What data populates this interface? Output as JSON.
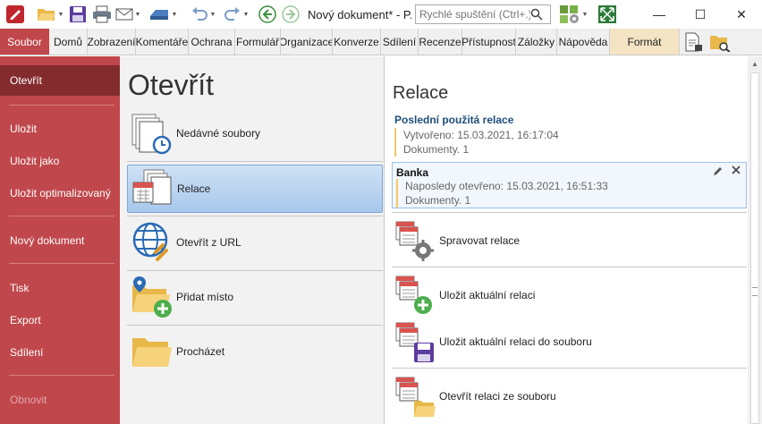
{
  "window": {
    "title": "Nový dokument* - P...",
    "quick_launch_placeholder": "Rychlé spuštění (Ctrl+.)",
    "minimize_label": "—",
    "maximize_label": "☐",
    "close_label": "✕"
  },
  "ribbon": {
    "tabs": [
      "Soubor",
      "Domů",
      "Zobrazení",
      "Komentáře",
      "Ochrana",
      "Formulář",
      "Organizace",
      "Konverze",
      "Sdílení",
      "Recenze",
      "Přístupnost",
      "Záložky",
      "Nápověda",
      "Formát"
    ]
  },
  "left_menu": {
    "items": [
      {
        "label": "Otevřít",
        "state": "active"
      },
      {
        "label": "Uložit",
        "state": "normal"
      },
      {
        "label": "Uložit jako",
        "state": "normal"
      },
      {
        "label": "Uložit optimalizovaný",
        "state": "normal"
      },
      {
        "label": "Nový dokument",
        "state": "normal"
      },
      {
        "label": "Tisk",
        "state": "normal"
      },
      {
        "label": "Export",
        "state": "normal"
      },
      {
        "label": "Sdílení",
        "state": "normal"
      },
      {
        "label": "Obnovit",
        "state": "disabled"
      }
    ]
  },
  "open_pane": {
    "title": "Otevřít",
    "items": [
      {
        "label": "Nedávné soubory",
        "icon": "recent-files-icon"
      },
      {
        "label": "Relace",
        "icon": "sessions-icon",
        "selected": true
      },
      {
        "label": "Otevřít z URL",
        "icon": "open-url-icon"
      },
      {
        "label": "Přidat místo",
        "icon": "add-place-icon"
      },
      {
        "label": "Procházet",
        "icon": "browse-folder-icon"
      }
    ]
  },
  "sessions_pane": {
    "title": "Relace",
    "recent_heading": "Poslední použitá relace",
    "recent_created": "Vytvořeno: 15.03.2021, 16:17:04",
    "recent_documents": "Dokumenty. 1",
    "session": {
      "name": "Banka",
      "last_opened": "Naposledy otevřeno: 15.03.2021, 16:51:33",
      "documents": "Dokumenty. 1"
    },
    "actions": [
      {
        "label": "Spravovat relace",
        "icon": "manage-sessions-icon"
      },
      {
        "label": "Uložit aktuální relaci",
        "icon": "save-session-icon"
      },
      {
        "label": "Uložit aktuální relaci do souboru",
        "icon": "save-session-to-file-icon"
      },
      {
        "label": "Otevřít relaci ze souboru",
        "icon": "open-session-from-file-icon"
      }
    ]
  },
  "colors": {
    "file_tab": "#c0474b",
    "left_active": "#842b2e",
    "selected_item": "#a8c8ec",
    "heading_blue": "#1f4e79",
    "accent_border": "#f0c86a"
  }
}
